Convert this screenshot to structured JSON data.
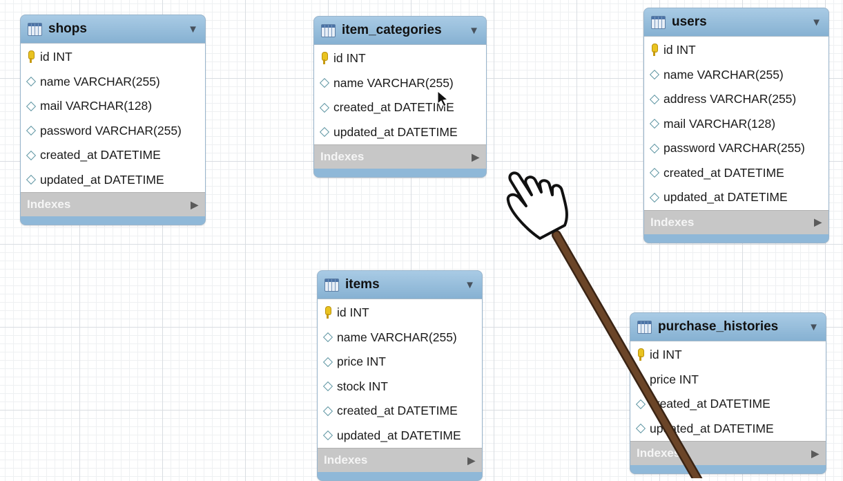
{
  "tables": {
    "shops": {
      "name": "shops",
      "columns": [
        "id INT",
        "name VARCHAR(255)",
        "mail VARCHAR(128)",
        "password VARCHAR(255)",
        "created_at DATETIME",
        "updated_at DATETIME"
      ],
      "indexes_label": "Indexes"
    },
    "item_categories": {
      "name": "item_categories",
      "columns": [
        "id INT",
        "name VARCHAR(255)",
        "created_at DATETIME",
        "updated_at DATETIME"
      ],
      "indexes_label": "Indexes"
    },
    "users": {
      "name": "users",
      "columns": [
        "id INT",
        "name VARCHAR(255)",
        "address VARCHAR(255)",
        "mail VARCHAR(128)",
        "password VARCHAR(255)",
        "created_at DATETIME",
        "updated_at DATETIME"
      ],
      "indexes_label": "Indexes"
    },
    "items": {
      "name": "items",
      "columns": [
        "id INT",
        "name VARCHAR(255)",
        "price INT",
        "stock INT",
        "created_at DATETIME",
        "updated_at DATETIME"
      ],
      "indexes_label": "Indexes"
    },
    "purchase_histories": {
      "name": "purchase_histories",
      "columns": [
        "id INT",
        "price INT",
        "created_at DATETIME",
        "updated_at DATETIME"
      ],
      "indexes_label": "Indexes"
    }
  },
  "colors": {
    "header": "#8fb8d8",
    "primary_key": "#e9c320",
    "column_marker": "#5f96a3",
    "indexes_bar": "#c7c7c7",
    "pointer_stick": "#5a3a22"
  },
  "icons": {
    "table": "table-icon",
    "primary_key": "key-icon",
    "column": "diamond-icon",
    "collapse": "caret-down-icon",
    "expand": "triangle-right-icon",
    "pointer": "hand-pointer-icon"
  }
}
